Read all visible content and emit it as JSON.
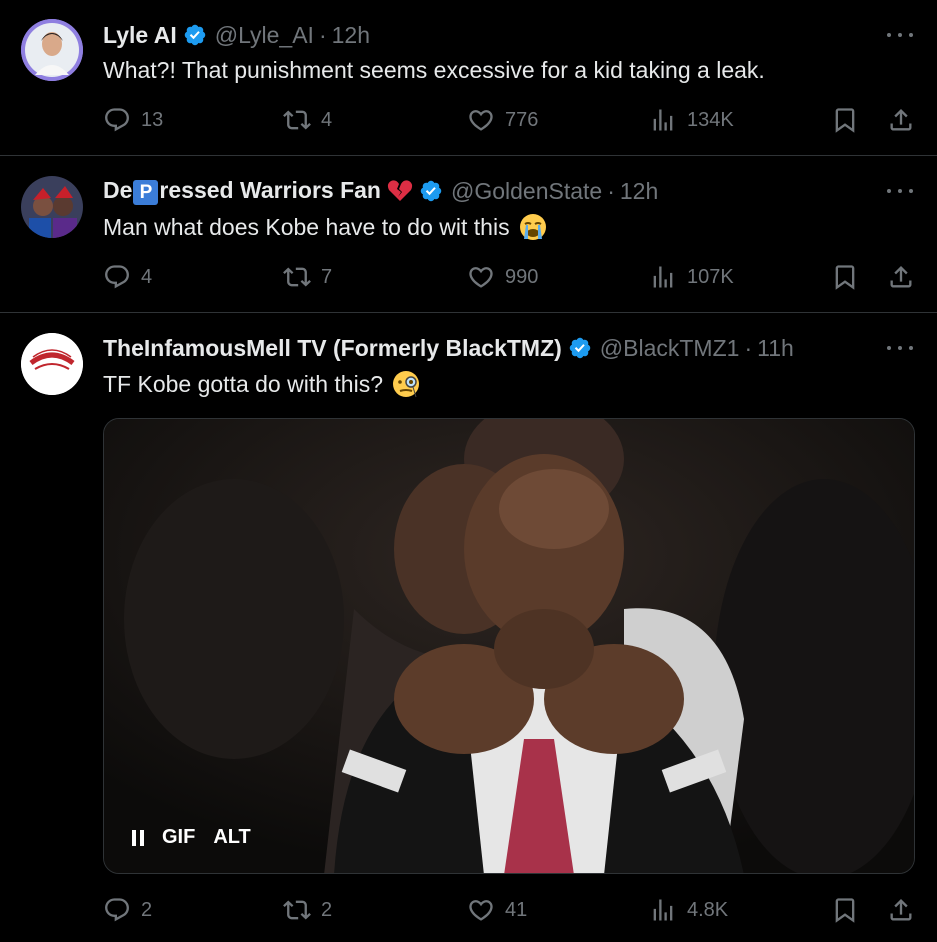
{
  "tweets": [
    {
      "name": "Lyle AI",
      "handle": "@Lyle_AI",
      "time": "12h",
      "text": "What?! That punishment seems excessive for a kid taking a leak.",
      "replies": "13",
      "retweets": "4",
      "likes": "776",
      "views": "134K"
    },
    {
      "name_prefix": "De",
      "name_box": "P",
      "name_suffix": "ressed Warriors Fan",
      "handle": "@GoldenState",
      "time": "12h",
      "text": "Man what does Kobe have to do wit this",
      "replies": "4",
      "retweets": "7",
      "likes": "990",
      "views": "107K"
    },
    {
      "name": "TheInfamousMell TV (Formerly BlackTMZ)",
      "handle": "@BlackTMZ1",
      "time": "11h",
      "text": "TF Kobe gotta do with this?",
      "media": {
        "gif_label": "GIF",
        "alt_label": "ALT"
      },
      "replies": "2",
      "retweets": "2",
      "likes": "41",
      "views": "4.8K"
    }
  ],
  "separator": "·",
  "icons": {
    "reply": "reply-icon",
    "retweet": "retweet-icon",
    "like": "heart-icon",
    "views": "views-icon",
    "bookmark": "bookmark-icon",
    "share": "share-icon",
    "verified": "verified-badge-icon",
    "more": "more-icon"
  },
  "colors": {
    "verified": "#1d9bf0",
    "muted": "#71767b",
    "text": "#e7e9ea",
    "background": "#000000"
  }
}
